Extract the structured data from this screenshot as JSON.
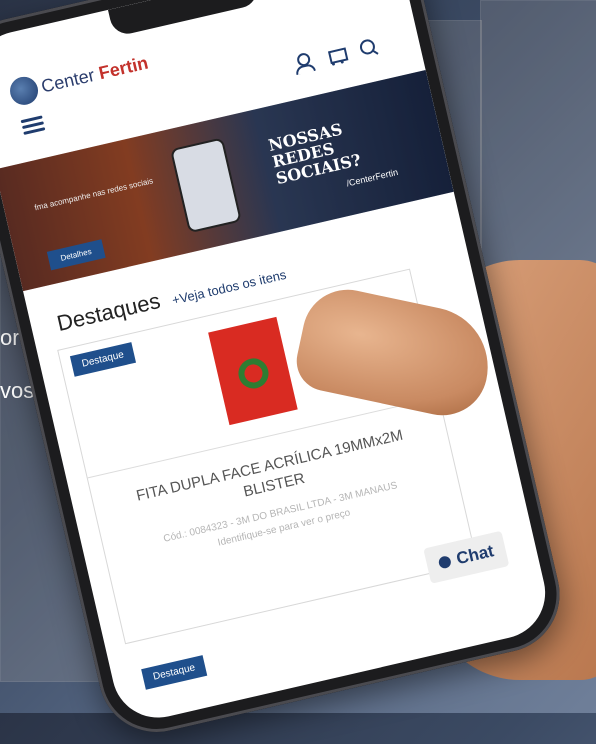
{
  "background": {
    "text_line_1": "ores",
    "text_line_2": "vos"
  },
  "app": {
    "brand_prefix": "Center ",
    "brand_accent": "Fertin"
  },
  "banner": {
    "small_text": "fma acompanhe nas redes sociais",
    "headline": "NOSSAS REDES SOCIAIS?",
    "handle": "/CenterFertin",
    "button_label": "Detalhes"
  },
  "highlights": {
    "title": "Destaques",
    "link": "+Veja todos os itens"
  },
  "product": {
    "badge": "Destaque",
    "name": "FITA DUPLA FACE ACRÍLICA 19MMx2M BLISTER",
    "code": "Cód.: 0084323 - 3M DO BRASIL LTDA - 3M MANAUS",
    "price_note": "Identifique-se para ver o preço"
  },
  "second_badge": "Destaque",
  "chat": {
    "label": "Chat"
  },
  "colors": {
    "brand_blue": "#1f3c6e",
    "brand_red": "#c3322c",
    "badge_blue": "#1f4f8c"
  }
}
